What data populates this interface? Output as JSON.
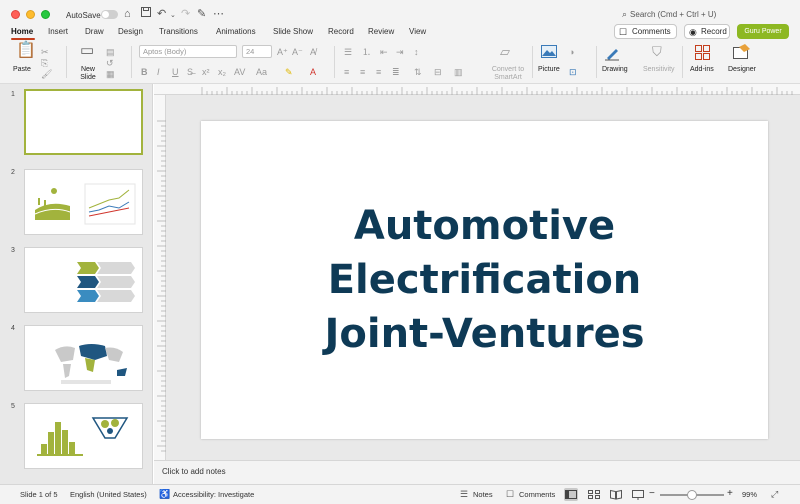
{
  "titlebar": {
    "autosave_label": "AutoSave",
    "search_placeholder": "Search (Cmd + Ctrl + U)"
  },
  "tabs": [
    "Home",
    "Insert",
    "Draw",
    "Design",
    "Transitions",
    "Animations",
    "Slide Show",
    "Record",
    "Review",
    "View"
  ],
  "actions": {
    "comments": "Comments",
    "record": "Record",
    "guru": "Guru Power"
  },
  "ribbon": {
    "paste": "Paste",
    "new_slide": "New Slide",
    "font_name": "Aptos (Body)",
    "font_size": "24",
    "convert_smartart": "Convert to SmartArt",
    "picture": "Picture",
    "drawing": "Drawing",
    "sensitivity": "Sensitivity",
    "add_ins": "Add-ins",
    "designer": "Designer"
  },
  "thumbnails": [
    {
      "num": "1"
    },
    {
      "num": "2"
    },
    {
      "num": "3"
    },
    {
      "num": "4"
    },
    {
      "num": "5"
    }
  ],
  "slide": {
    "title_lines": [
      "Automotive",
      "Electrification",
      "Joint-Ventures"
    ]
  },
  "notes": {
    "placeholder": "Click to add notes"
  },
  "status": {
    "slide_indicator": "Slide 1 of 5",
    "language": "English (United States)",
    "accessibility": "Accessibility: Investigate",
    "notes": "Notes",
    "comments": "Comments",
    "zoom": "99%"
  },
  "colors": {
    "accent_tab": "#c43e1c",
    "guru_button": "#8db822",
    "title_text": "#0e3a56",
    "thumb_selected_border": "#a2b33d"
  }
}
